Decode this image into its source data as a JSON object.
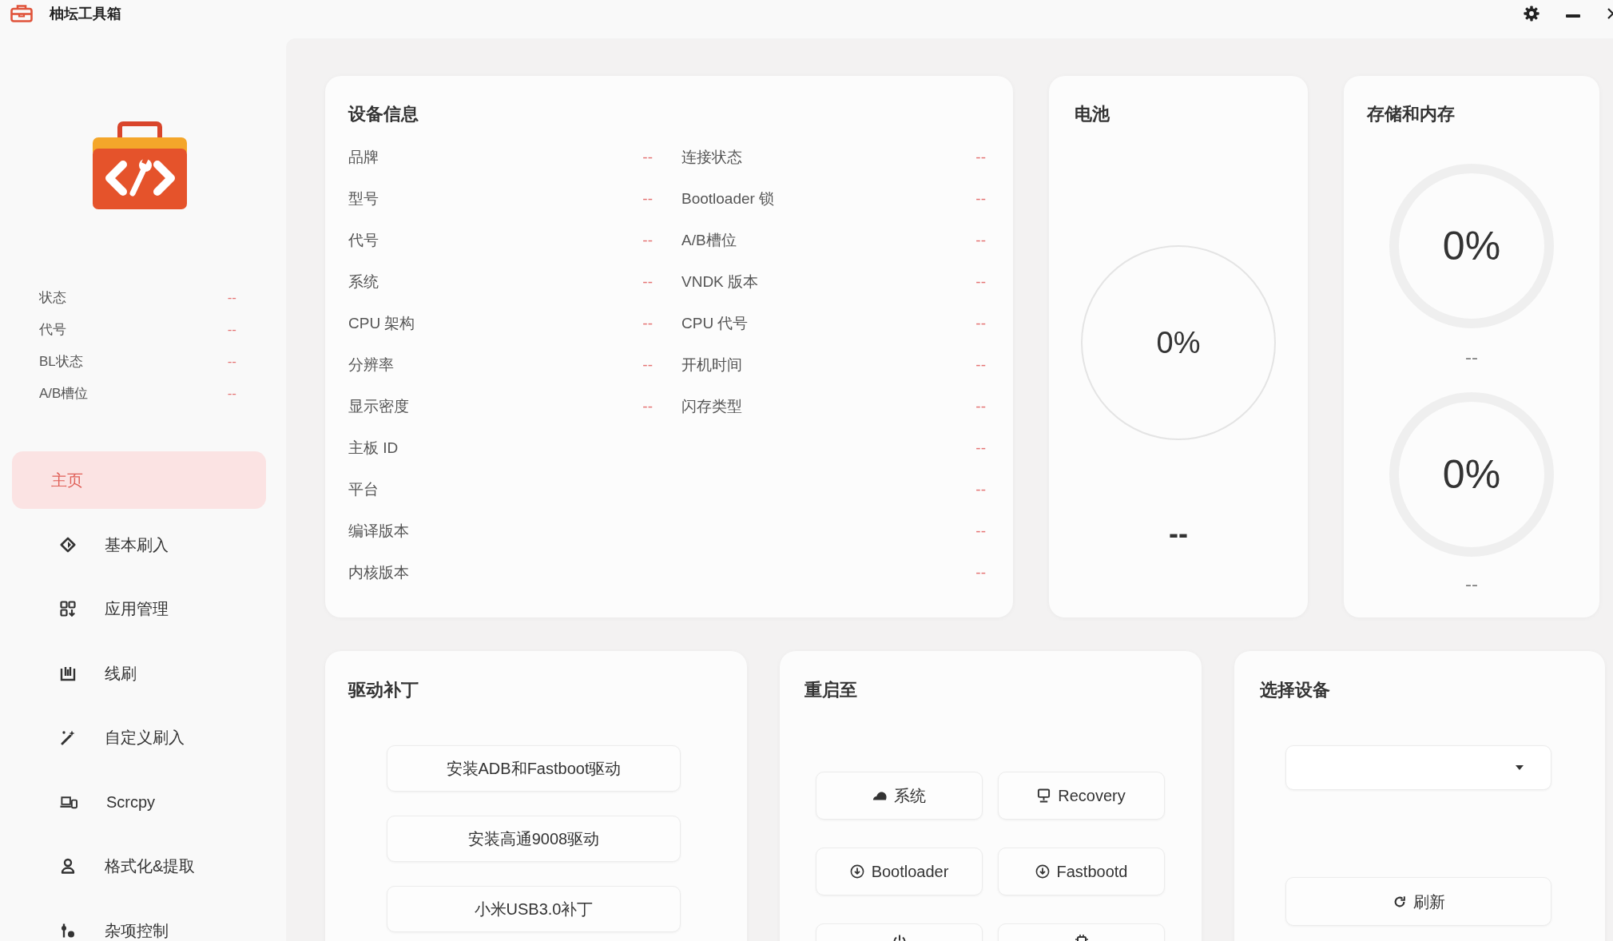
{
  "window": {
    "title": "柚坛工具箱"
  },
  "sidebar": {
    "device_status": [
      {
        "label": "状态",
        "value": "--"
      },
      {
        "label": "代号",
        "value": "--"
      },
      {
        "label": "BL状态",
        "value": "--"
      },
      {
        "label": "A/B槽位",
        "value": "--"
      }
    ],
    "nav_items": [
      {
        "kind": "home",
        "label": "主页",
        "selected": true
      },
      {
        "kind": "basic_flash",
        "label": "基本刷入",
        "selected": false
      },
      {
        "kind": "apps",
        "label": "应用管理",
        "selected": false
      },
      {
        "kind": "wire_flash",
        "label": "线刷",
        "selected": false
      },
      {
        "kind": "custom_flash",
        "label": "自定义刷入",
        "selected": false
      },
      {
        "kind": "scrcpy",
        "label": "Scrcpy",
        "selected": false
      },
      {
        "kind": "format",
        "label": "格式化&提取",
        "selected": false
      },
      {
        "kind": "misc",
        "label": "杂项控制",
        "selected": false
      }
    ]
  },
  "device_info": {
    "title": "设备信息",
    "rows": [
      {
        "cells": [
          {
            "label": "品牌",
            "value": "--"
          },
          {
            "label": "连接状态",
            "value": "--"
          }
        ]
      },
      {
        "cells": [
          {
            "label": "型号",
            "value": "--"
          },
          {
            "label": "Bootloader 锁",
            "value": "--"
          }
        ]
      },
      {
        "cells": [
          {
            "label": "代号",
            "value": "--"
          },
          {
            "label": "A/B槽位",
            "value": "--"
          }
        ]
      },
      {
        "cells": [
          {
            "label": "系统",
            "value": "--"
          },
          {
            "label": "VNDK 版本",
            "value": "--"
          }
        ]
      },
      {
        "cells": [
          {
            "label": "CPU 架构",
            "value": "--"
          },
          {
            "label": "CPU 代号",
            "value": "--"
          }
        ]
      },
      {
        "cells": [
          {
            "label": "分辨率",
            "value": "--"
          },
          {
            "label": "开机时间",
            "value": "--"
          }
        ]
      },
      {
        "cells": [
          {
            "label": "显示密度",
            "value": "--"
          },
          {
            "label": "闪存类型",
            "value": "--"
          }
        ]
      },
      {
        "cells": [
          {
            "label": "主板 ID",
            "value": "--"
          }
        ]
      },
      {
        "cells": [
          {
            "label": "平台",
            "value": "--"
          }
        ]
      },
      {
        "cells": [
          {
            "label": "编译版本",
            "value": "--"
          }
        ]
      },
      {
        "cells": [
          {
            "label": "内核版本",
            "value": "--"
          }
        ]
      }
    ]
  },
  "battery": {
    "title": "电池",
    "reading": "0%",
    "detail": "--"
  },
  "storage": {
    "title": "存储和内存",
    "gauges": [
      {
        "reading": "0%",
        "detail": "--"
      },
      {
        "reading": "0%",
        "detail": "--"
      }
    ]
  },
  "driver_patches": {
    "title": "驱动补丁",
    "buttons": [
      "安装ADB和Fastboot驱动",
      "安装高通9008驱动",
      "小米USB3.0补丁"
    ]
  },
  "reboot": {
    "title": "重启至",
    "buttons": [
      {
        "kind": "system",
        "label": "系统"
      },
      {
        "kind": "recovery",
        "label": "Recovery"
      },
      {
        "kind": "bootloader",
        "label": "Bootloader"
      },
      {
        "kind": "fastbootd",
        "label": "Fastbootd"
      },
      {
        "kind": "power"
      },
      {
        "kind": "chip"
      }
    ]
  },
  "device_select": {
    "title": "选择设备",
    "refresh_button": "刷新"
  }
}
